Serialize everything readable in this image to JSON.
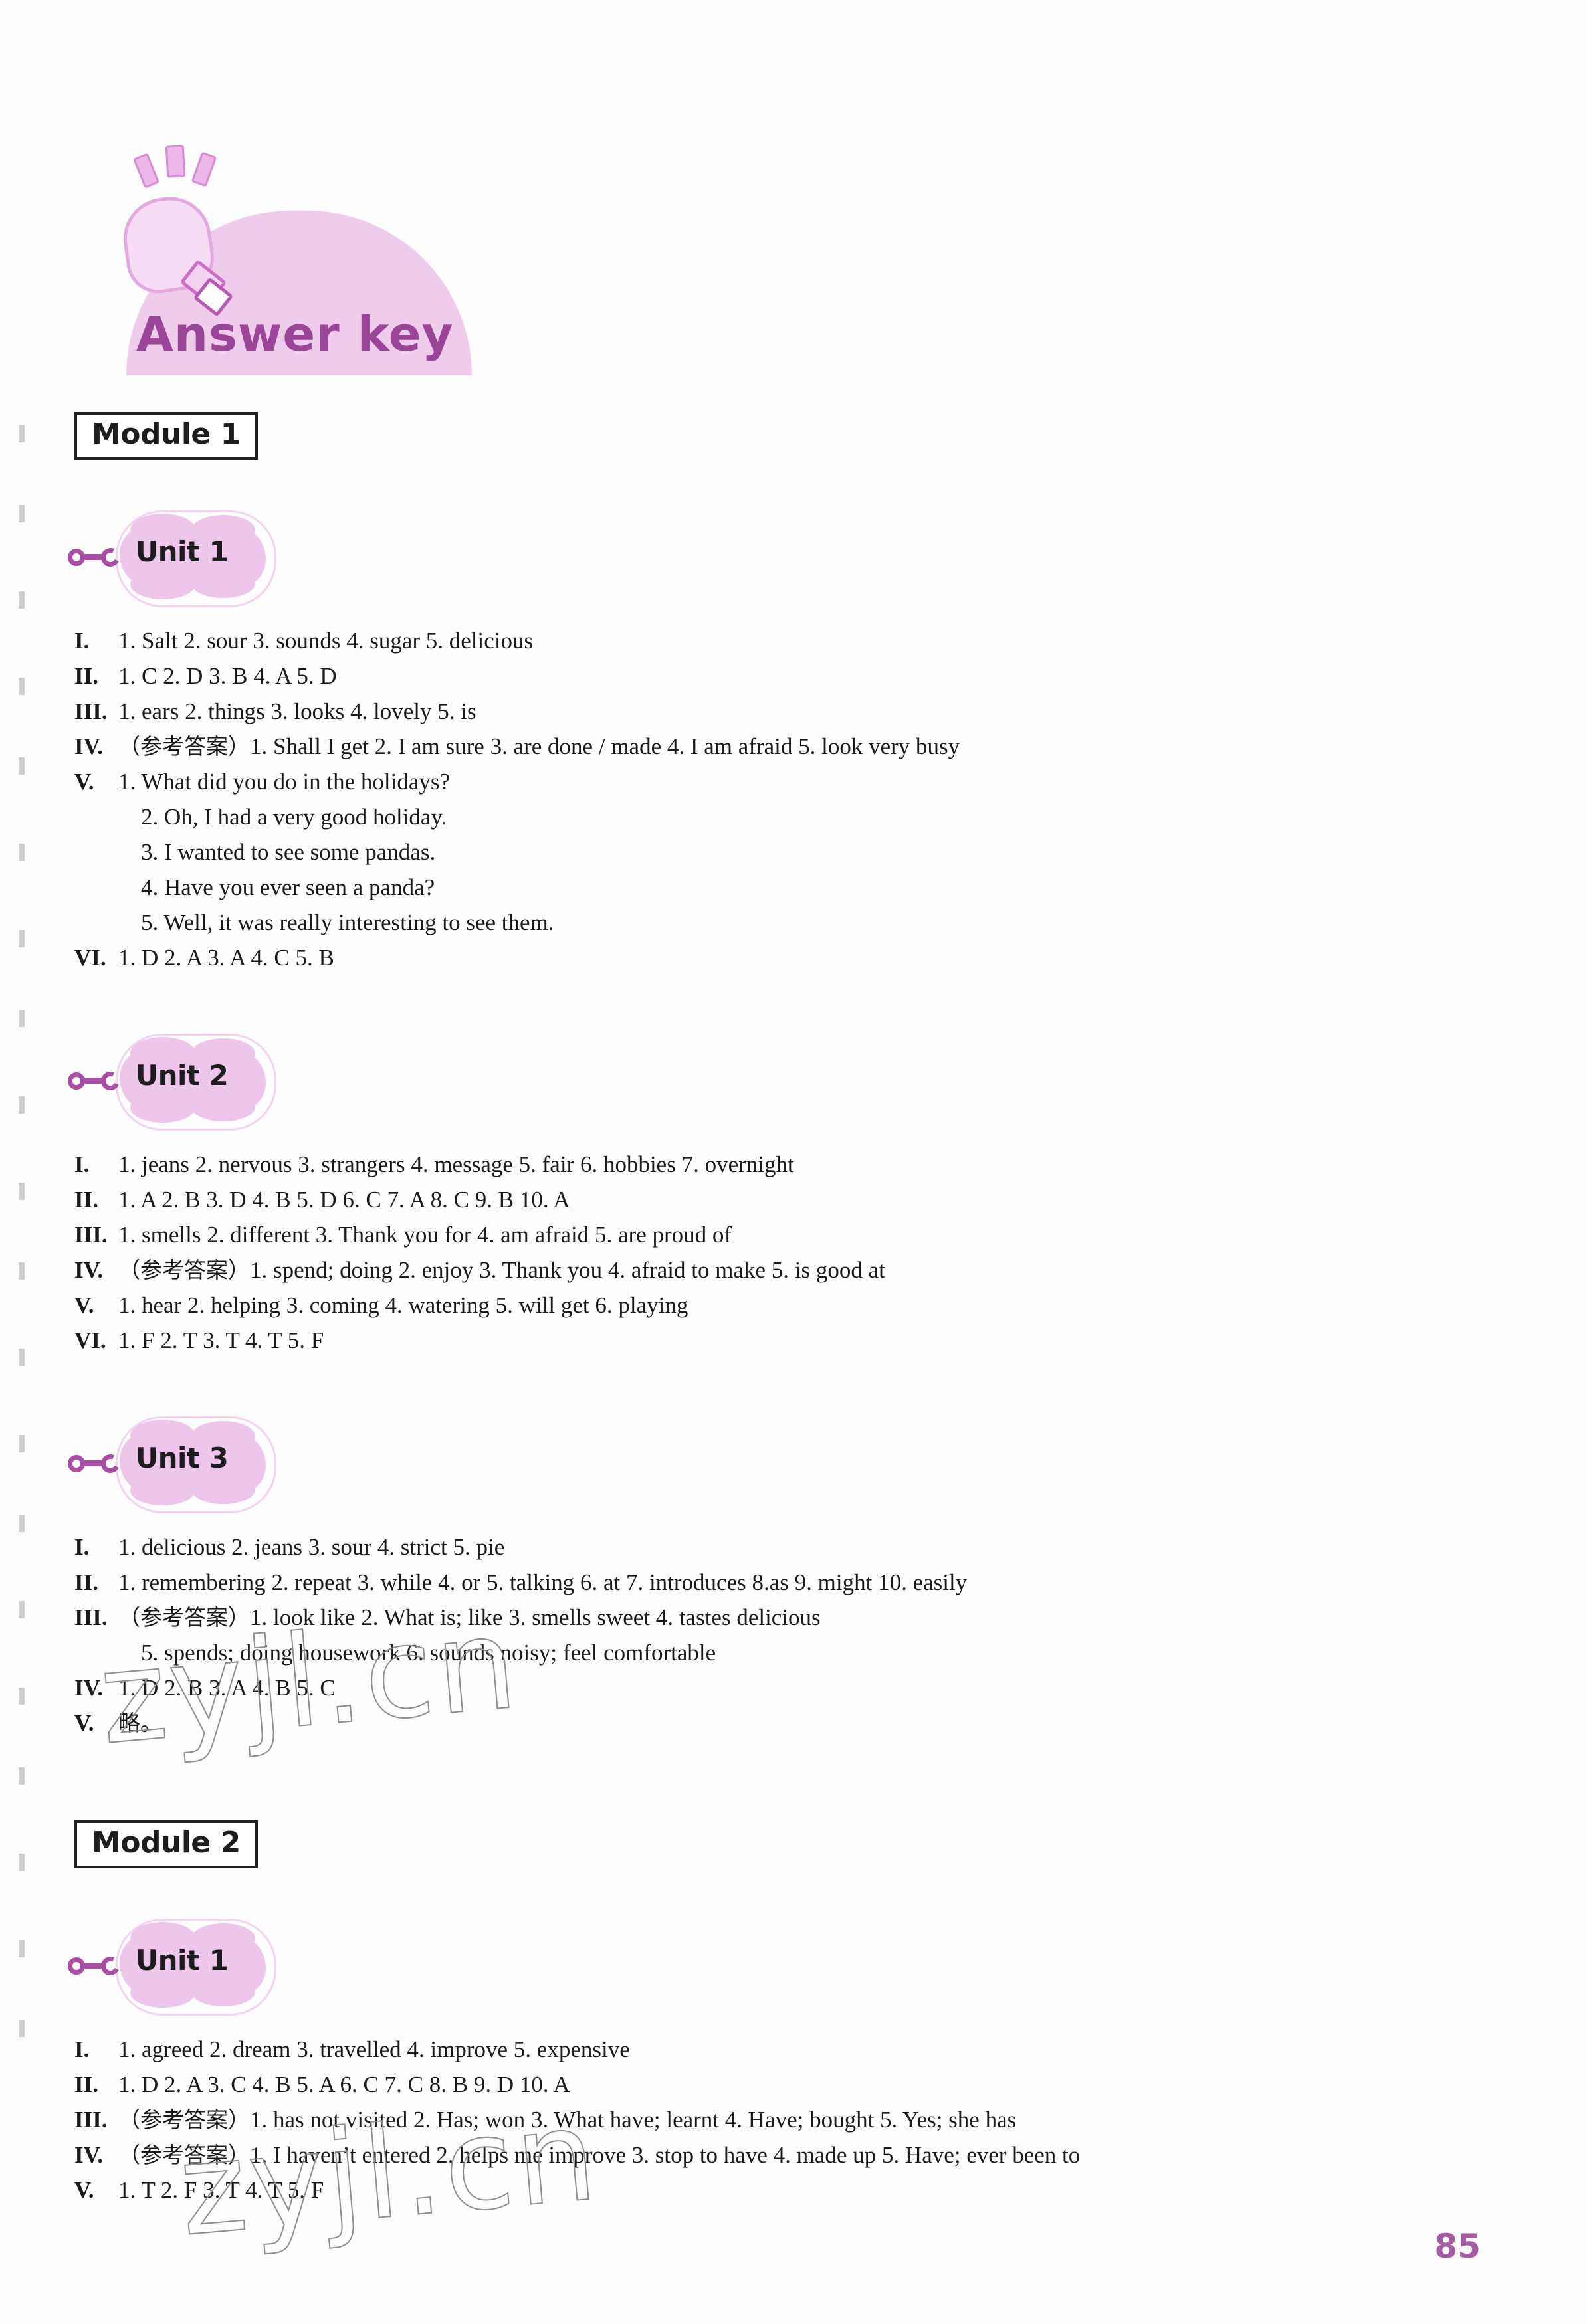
{
  "page": {
    "number": "85",
    "watermark_text": "zyjl.cn"
  },
  "header": {
    "title": "Answer key",
    "icon": "lightbulb-icon"
  },
  "modules": [
    {
      "label": "Module 1",
      "units": [
        {
          "label": "Unit 1",
          "lines": [
            {
              "num": "I.",
              "text": "1. Salt   2. sour   3. sounds   4. sugar   5. delicious",
              "cont": false
            },
            {
              "num": "II.",
              "text": "1. C   2. D   3. B   4. A   5. D",
              "cont": false
            },
            {
              "num": "III.",
              "text": "1. ears   2. things   3. looks   4. lovely   5. is",
              "cont": false
            },
            {
              "num": "IV.",
              "text": "（参考答案）1. Shall I get   2. I am sure   3. are done / made   4. I am afraid   5. look very busy",
              "cont": false,
              "cjk": true
            },
            {
              "num": "V.",
              "text": "1. What did you do in the holidays?",
              "cont": false
            },
            {
              "num": "",
              "text": "2. Oh, I had a very good holiday.",
              "cont": true
            },
            {
              "num": "",
              "text": "3. I wanted to see some pandas.",
              "cont": true
            },
            {
              "num": "",
              "text": "4. Have you ever seen a panda?",
              "cont": true
            },
            {
              "num": "",
              "text": "5. Well, it was really interesting to see them.",
              "cont": true
            },
            {
              "num": "VI.",
              "text": "1. D   2. A   3. A   4. C   5. B",
              "cont": false
            }
          ]
        },
        {
          "label": "Unit 2",
          "lines": [
            {
              "num": "I.",
              "text": "1. jeans   2. nervous   3. strangers   4. message   5. fair   6. hobbies   7. overnight",
              "cont": false
            },
            {
              "num": "II.",
              "text": "1. A   2. B   3. D   4. B   5. D   6. C   7. A   8. C   9. B   10. A",
              "cont": false
            },
            {
              "num": "III.",
              "text": "1. smells   2. different   3. Thank you for   4. am afraid   5. are proud of",
              "cont": false
            },
            {
              "num": "IV.",
              "text": "（参考答案）1. spend; doing   2. enjoy   3. Thank you   4. afraid to make   5. is good at",
              "cont": false,
              "cjk": true
            },
            {
              "num": "V.",
              "text": "1. hear   2. helping   3. coming   4. watering   5. will get   6. playing",
              "cont": false
            },
            {
              "num": "VI.",
              "text": "1. F   2. T   3. T   4. T   5. F",
              "cont": false
            }
          ]
        },
        {
          "label": "Unit 3",
          "lines": [
            {
              "num": "I.",
              "text": "1. delicious   2. jeans   3. sour   4. strict   5. pie",
              "cont": false
            },
            {
              "num": "II.",
              "text": "1. remembering   2. repeat   3. while   4. or   5. talking   6. at   7. introduces   8.as   9. might   10. easily",
              "cont": false
            },
            {
              "num": "III.",
              "text": "（参考答案）1. look like   2. What is; like   3. smells sweet   4. tastes delicious",
              "cont": false,
              "cjk": true
            },
            {
              "num": "",
              "text": "5. spends; doing housework   6. sounds noisy; feel comfortable",
              "cont": true
            },
            {
              "num": "IV.",
              "text": "1. D   2. B   3. A   4. B   5. C",
              "cont": false
            },
            {
              "num": "V.",
              "text": "略。",
              "cont": false,
              "cjk": true
            }
          ]
        }
      ]
    },
    {
      "label": "Module 2",
      "units": [
        {
          "label": "Unit 1",
          "lines": [
            {
              "num": "I.",
              "text": "1. agreed   2. dream   3. travelled   4. improve   5. expensive",
              "cont": false
            },
            {
              "num": "II.",
              "text": "1. D   2. A   3. C   4. B   5. A   6. C   7. C   8. B   9. D   10. A",
              "cont": false
            },
            {
              "num": "III.",
              "text": "（参考答案）1. has not visited   2. Has; won   3. What have; learnt   4. Have; bought   5. Yes; she has",
              "cont": false,
              "cjk": true
            },
            {
              "num": "IV.",
              "text": "（参考答案）1. I haven’t entered   2. helps me improve   3. stop to have   4. made up   5. Have; ever been to",
              "cont": false,
              "cjk": true
            },
            {
              "num": "V.",
              "text": "1. T   2. F   3. T   4. T   5. F",
              "cont": false
            }
          ]
        }
      ]
    }
  ],
  "colors": {
    "accent_pink": "#eec6ec",
    "accent_purple": "#9a4597",
    "text": "#1a1a1a"
  }
}
